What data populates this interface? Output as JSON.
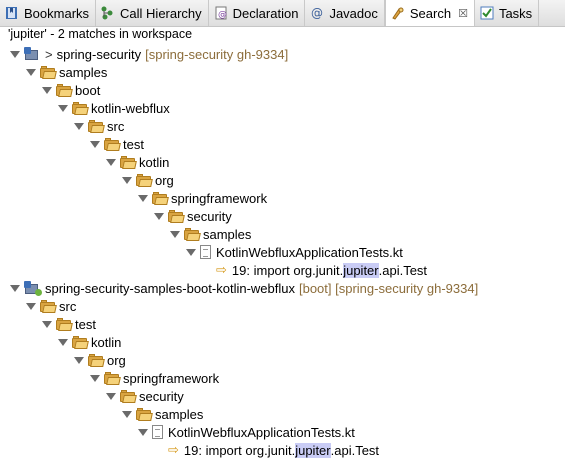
{
  "tabs": [
    {
      "label": "Bookmarks",
      "icon": "bookmarks-icon",
      "active": false
    },
    {
      "label": "Call Hierarchy",
      "icon": "call-hierarchy-icon",
      "active": false
    },
    {
      "label": "Declaration",
      "icon": "declaration-icon",
      "active": false
    },
    {
      "label": "Javadoc",
      "icon": "javadoc-icon",
      "active": false
    },
    {
      "label": "Search",
      "icon": "search-icon",
      "active": true,
      "close": "☒"
    },
    {
      "label": "Tasks",
      "icon": "tasks-icon",
      "active": false
    }
  ],
  "status": "'jupiter' - 2 matches in workspace",
  "tree": {
    "p1": {
      "prefix": ">",
      "name": "spring-security",
      "decoration": "[spring-security gh-9334]"
    },
    "p1_nodes": [
      "samples",
      "boot",
      "kotlin-webflux",
      "src",
      "test",
      "kotlin",
      "org",
      "springframework",
      "security",
      "samples"
    ],
    "p1_file": "KotlinWebfluxApplicationTests.kt",
    "p1_match": {
      "line": "19:",
      "before": "import org.junit.",
      "hit": "jupiter",
      "after": ".api.Test"
    },
    "p2": {
      "name": "spring-security-samples-boot-kotlin-webflux",
      "decoration": "[boot] [spring-security gh-9334]"
    },
    "p2_nodes": [
      "src",
      "test",
      "kotlin",
      "org",
      "springframework",
      "security",
      "samples"
    ],
    "p2_file": "KotlinWebfluxApplicationTests.kt",
    "p2_match": {
      "line": "19:",
      "before": "import org.junit.",
      "hit": "jupiter",
      "after": ".api.Test"
    }
  },
  "colors": {
    "highlight": "#c9ccf5",
    "decoration": "#8c6d3b",
    "folder": "#d9a441",
    "match_arrow": "#d69a1d"
  }
}
